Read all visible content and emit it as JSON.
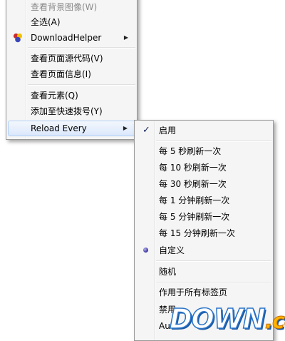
{
  "main_menu": {
    "items": [
      {
        "label": "查看背景图像(W)",
        "disabled": true
      },
      {
        "label": "全选(A)"
      },
      {
        "label": "DownloadHelper",
        "icon": "downloadhelper-icon",
        "submenu": true
      },
      {
        "label": "查看页面源代码(V)"
      },
      {
        "label": "查看页面信息(I)"
      },
      {
        "label": "查看元素(Q)"
      },
      {
        "label": "添加至快速拨号(Y)"
      },
      {
        "label": "Reload Every",
        "submenu": true,
        "highlighted": true
      }
    ]
  },
  "sub_menu": {
    "items": [
      {
        "label": "启用",
        "checked": true
      },
      {
        "label": "每 5 秒刷新一次"
      },
      {
        "label": "每 10 秒刷新一次"
      },
      {
        "label": "每 30 秒刷新一次"
      },
      {
        "label": "每 1 分钟刷新一次"
      },
      {
        "label": "每 5 分钟刷新一次"
      },
      {
        "label": "每 15 分钟刷新一次"
      },
      {
        "label": "自定义",
        "radio_selected": true
      },
      {
        "label": "随机"
      },
      {
        "label": "作用于所有标签页"
      },
      {
        "label": "禁用"
      },
      {
        "label": "Au"
      }
    ]
  },
  "watermark": {
    "main": "DOWN",
    "suffix": ".cc"
  },
  "colors": {
    "highlight_border": "#aecff7",
    "menu_bg": "#f5f5f5",
    "watermark_blue": "#2a74c8"
  }
}
